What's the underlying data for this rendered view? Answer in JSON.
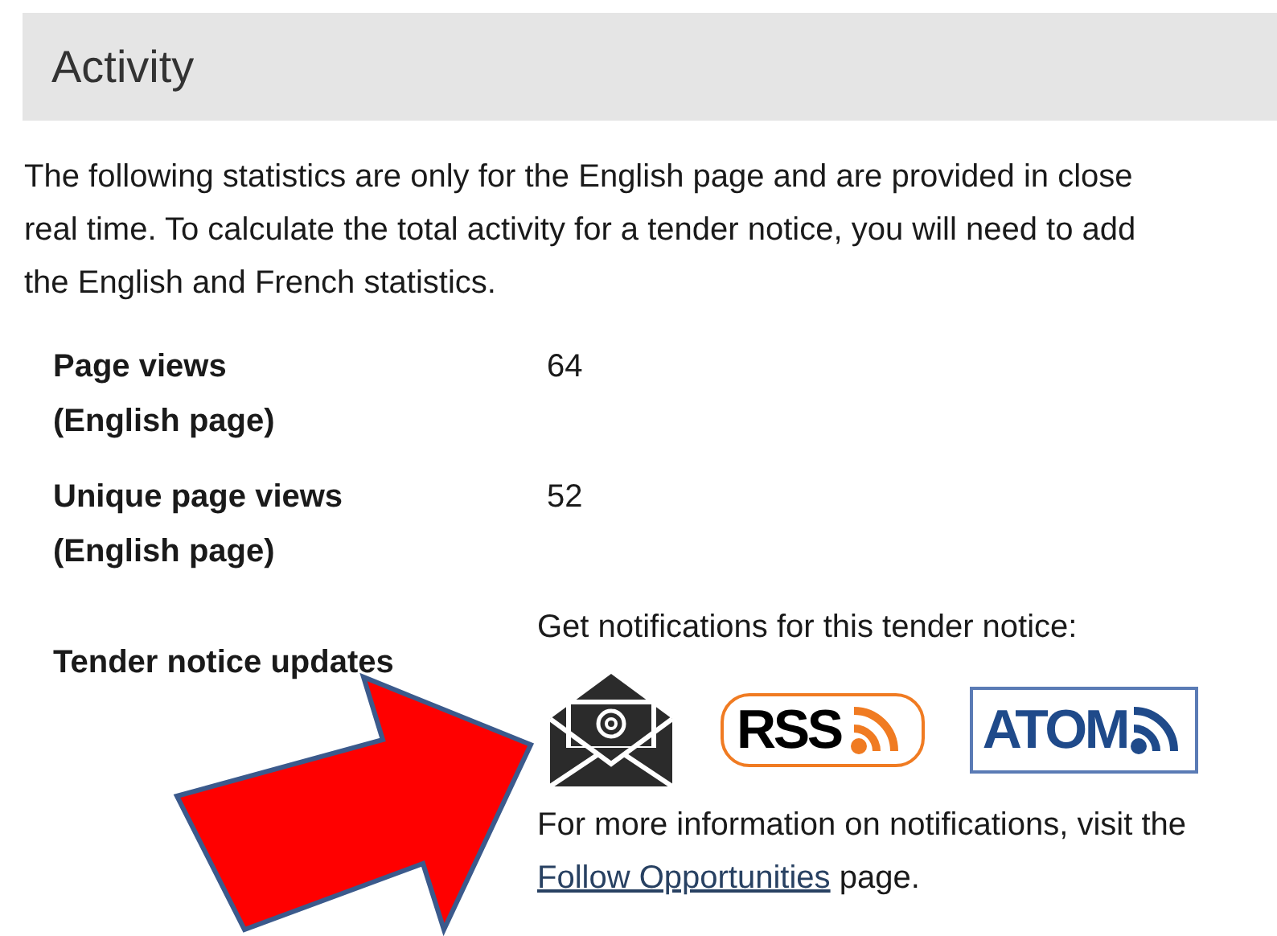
{
  "heading": "Activity",
  "intro": "The following statistics are only for the English page and are provided in close\nreal time. To calculate the total activity for a tender notice, you will need to add\nthe English and French statistics.",
  "stats": [
    {
      "label": "Page views\n(English page)",
      "value": "64"
    },
    {
      "label": "Unique page views\n(English page)",
      "value": "52"
    }
  ],
  "updates": {
    "label": "Tender notice updates",
    "prompt": "Get notifications for this tender notice:",
    "rss_label": "RSS",
    "atom_label": "ATOM",
    "info": "For more information on notifications, visit the",
    "link": "Follow Opportunities",
    "info_end": "page."
  }
}
